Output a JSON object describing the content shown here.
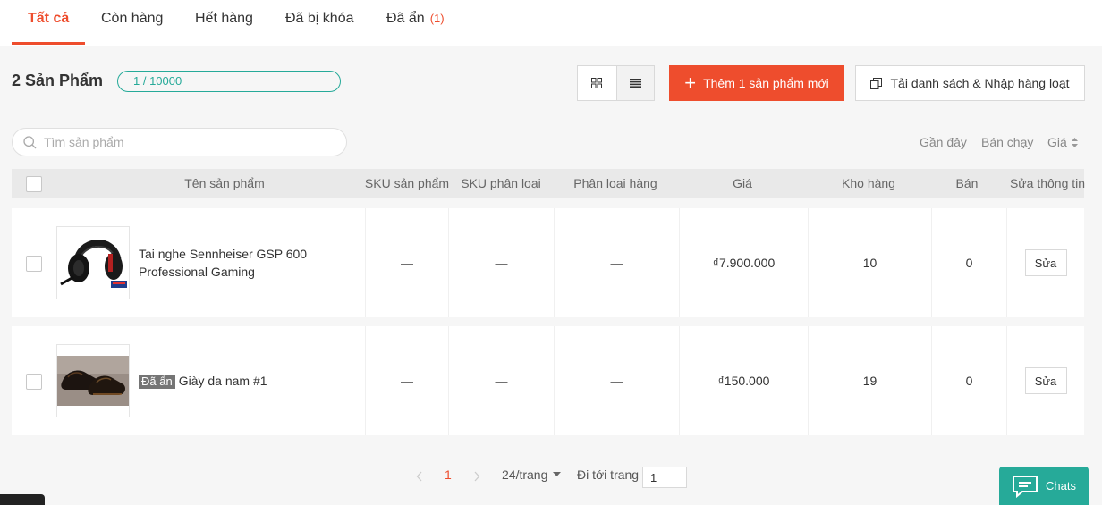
{
  "tabs": [
    {
      "label": "Tất cả",
      "count": ""
    },
    {
      "label": "Còn hàng",
      "count": ""
    },
    {
      "label": "Hết hàng",
      "count": ""
    },
    {
      "label": "Đã bị khóa",
      "count": ""
    },
    {
      "label": "Đã ẩn",
      "count": "(1)"
    }
  ],
  "summary": {
    "title": "2 Sản Phẩm",
    "quota": "1 / 10000"
  },
  "actions": {
    "add_label": "Thêm 1 sản phẩm mới",
    "bulk_label": "Tải danh sách & Nhập hàng loạt"
  },
  "search": {
    "placeholder": "Tìm sản phẩm",
    "value": ""
  },
  "sort": {
    "recent": "Gần đây",
    "best_selling": "Bán chạy",
    "price": "Giá"
  },
  "table": {
    "headers": [
      "Tên sản phẩm",
      "SKU sản phẩm",
      "SKU phân loại",
      "Phân loại hàng",
      "Giá",
      "Kho hàng",
      "Bán",
      "Sửa thông tin"
    ],
    "rows": [
      {
        "tag": "",
        "name": "Tai nghe Sennheiser GSP 600 Professional Gaming",
        "sku": "—",
        "variant_sku": "—",
        "variant": "—",
        "price": "₫7.900.000",
        "stock": "10",
        "sold": "0",
        "edit": "Sửa"
      },
      {
        "tag": "Đã ẩn",
        "name": "Giày da nam #1",
        "sku": "—",
        "variant_sku": "—",
        "variant": "—",
        "price": "₫150.000",
        "stock": "19",
        "sold": "0",
        "edit": "Sửa"
      }
    ]
  },
  "pagination": {
    "current": "1",
    "per_page": "24/trang",
    "goto_label": "Đi tới trang",
    "goto_value": "1"
  },
  "chat": {
    "label": "Chats"
  },
  "colors": {
    "accent": "#ee4d2d",
    "teal": "#26aa99"
  }
}
